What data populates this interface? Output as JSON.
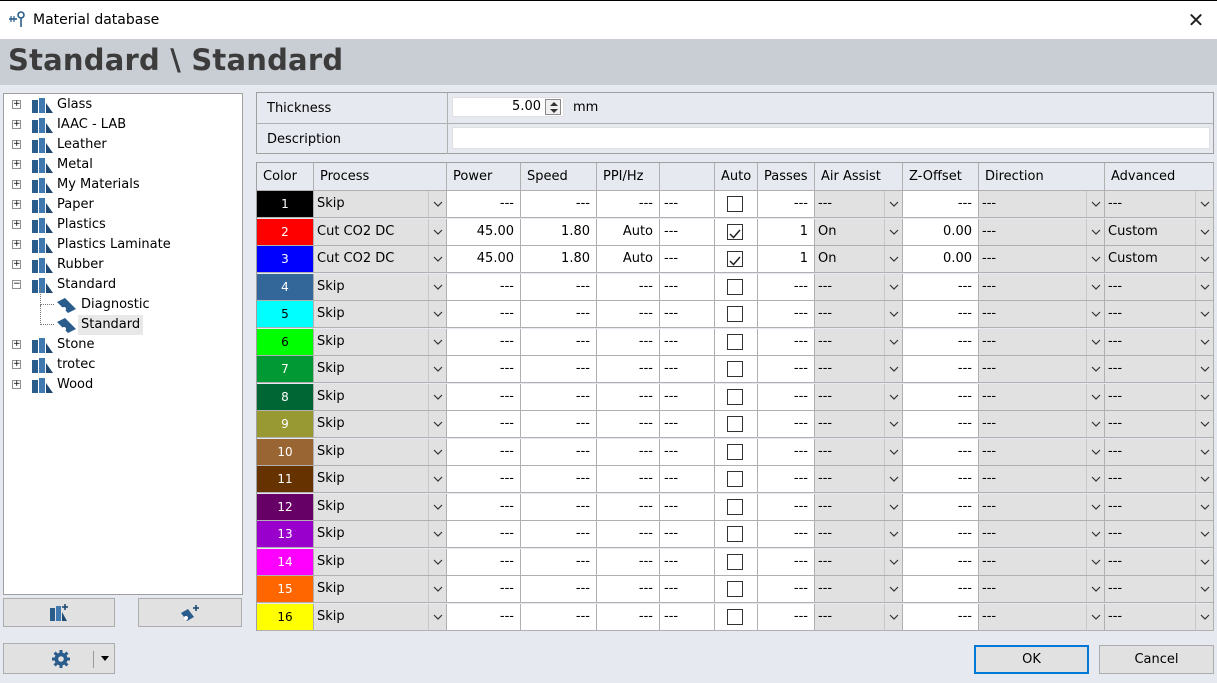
{
  "window": {
    "title": "Material database",
    "close_glyph": "✕"
  },
  "header": {
    "title": "Standard \\ Standard"
  },
  "tree": {
    "items": [
      {
        "label": "Glass",
        "kind": "folder",
        "expanded": false,
        "level": 0
      },
      {
        "label": "IAAC - LAB",
        "kind": "folder",
        "expanded": false,
        "level": 0
      },
      {
        "label": "Leather",
        "kind": "folder",
        "expanded": false,
        "level": 0
      },
      {
        "label": "Metal",
        "kind": "folder",
        "expanded": false,
        "level": 0
      },
      {
        "label": "My Materials",
        "kind": "folder",
        "expanded": false,
        "level": 0
      },
      {
        "label": "Paper",
        "kind": "folder",
        "expanded": false,
        "level": 0
      },
      {
        "label": "Plastics",
        "kind": "folder",
        "expanded": false,
        "level": 0
      },
      {
        "label": "Plastics Laminate",
        "kind": "folder",
        "expanded": false,
        "level": 0
      },
      {
        "label": "Rubber",
        "kind": "folder",
        "expanded": false,
        "level": 0
      },
      {
        "label": "Standard",
        "kind": "folder",
        "expanded": true,
        "level": 0
      },
      {
        "label": "Diagnostic",
        "kind": "material",
        "level": 1
      },
      {
        "label": "Standard",
        "kind": "material",
        "level": 1,
        "selected": true
      },
      {
        "label": "Stone",
        "kind": "folder",
        "expanded": false,
        "level": 0
      },
      {
        "label": "trotec",
        "kind": "folder",
        "expanded": false,
        "level": 0
      },
      {
        "label": "Wood",
        "kind": "folder",
        "expanded": false,
        "level": 0
      }
    ]
  },
  "toolbar": {
    "add_folder_icon": "add-folder-icon",
    "add_material_icon": "add-material-icon",
    "settings_icon": "gear-icon"
  },
  "properties": {
    "thickness_label": "Thickness",
    "thickness_value": "5.00",
    "thickness_unit": "mm",
    "description_label": "Description",
    "description_value": ""
  },
  "grid": {
    "headers": {
      "color": "Color",
      "process": "Process",
      "power": "Power",
      "speed": "Speed",
      "ppi": "PPI/Hz",
      "extra": "",
      "auto": "Auto",
      "passes": "Passes",
      "air_assist": "Air Assist",
      "z_offset": "Z-Offset",
      "direction": "Direction",
      "advanced": "Advanced"
    },
    "rows": [
      {
        "num": "1",
        "color": "#000000",
        "text_color": "#ffffff",
        "process": "Skip",
        "power": "---",
        "speed": "---",
        "ppi": "---",
        "extra": "---",
        "auto": false,
        "passes": "---",
        "air_assist": "---",
        "z_offset": "---",
        "direction": "---",
        "advanced": "---"
      },
      {
        "num": "2",
        "color": "#ff0000",
        "text_color": "#ffffff",
        "process": "Cut CO2 DC",
        "power": "45.00",
        "speed": "1.80",
        "ppi": "Auto",
        "extra": "---",
        "auto": true,
        "passes": "1",
        "air_assist": "On",
        "z_offset": "0.00",
        "direction": "---",
        "advanced": "Custom"
      },
      {
        "num": "3",
        "color": "#0000ff",
        "text_color": "#ffffff",
        "process": "Cut CO2 DC",
        "power": "45.00",
        "speed": "1.80",
        "ppi": "Auto",
        "extra": "---",
        "auto": true,
        "passes": "1",
        "air_assist": "On",
        "z_offset": "0.00",
        "direction": "---",
        "advanced": "Custom"
      },
      {
        "num": "4",
        "color": "#336699",
        "text_color": "#ffffff",
        "process": "Skip",
        "power": "---",
        "speed": "---",
        "ppi": "---",
        "extra": "---",
        "auto": false,
        "passes": "---",
        "air_assist": "---",
        "z_offset": "---",
        "direction": "---",
        "advanced": "---"
      },
      {
        "num": "5",
        "color": "#00ffff",
        "text_color": "#000000",
        "process": "Skip",
        "power": "---",
        "speed": "---",
        "ppi": "---",
        "extra": "---",
        "auto": false,
        "passes": "---",
        "air_assist": "---",
        "z_offset": "---",
        "direction": "---",
        "advanced": "---"
      },
      {
        "num": "6",
        "color": "#00ff00",
        "text_color": "#000000",
        "process": "Skip",
        "power": "---",
        "speed": "---",
        "ppi": "---",
        "extra": "---",
        "auto": false,
        "passes": "---",
        "air_assist": "---",
        "z_offset": "---",
        "direction": "---",
        "advanced": "---"
      },
      {
        "num": "7",
        "color": "#009933",
        "text_color": "#ffffff",
        "process": "Skip",
        "power": "---",
        "speed": "---",
        "ppi": "---",
        "extra": "---",
        "auto": false,
        "passes": "---",
        "air_assist": "---",
        "z_offset": "---",
        "direction": "---",
        "advanced": "---"
      },
      {
        "num": "8",
        "color": "#006633",
        "text_color": "#ffffff",
        "process": "Skip",
        "power": "---",
        "speed": "---",
        "ppi": "---",
        "extra": "---",
        "auto": false,
        "passes": "---",
        "air_assist": "---",
        "z_offset": "---",
        "direction": "---",
        "advanced": "---"
      },
      {
        "num": "9",
        "color": "#999933",
        "text_color": "#ffffff",
        "process": "Skip",
        "power": "---",
        "speed": "---",
        "ppi": "---",
        "extra": "---",
        "auto": false,
        "passes": "---",
        "air_assist": "---",
        "z_offset": "---",
        "direction": "---",
        "advanced": "---"
      },
      {
        "num": "10",
        "color": "#996633",
        "text_color": "#ffffff",
        "process": "Skip",
        "power": "---",
        "speed": "---",
        "ppi": "---",
        "extra": "---",
        "auto": false,
        "passes": "---",
        "air_assist": "---",
        "z_offset": "---",
        "direction": "---",
        "advanced": "---"
      },
      {
        "num": "11",
        "color": "#663300",
        "text_color": "#ffffff",
        "process": "Skip",
        "power": "---",
        "speed": "---",
        "ppi": "---",
        "extra": "---",
        "auto": false,
        "passes": "---",
        "air_assist": "---",
        "z_offset": "---",
        "direction": "---",
        "advanced": "---"
      },
      {
        "num": "12",
        "color": "#660066",
        "text_color": "#ffffff",
        "process": "Skip",
        "power": "---",
        "speed": "---",
        "ppi": "---",
        "extra": "---",
        "auto": false,
        "passes": "---",
        "air_assist": "---",
        "z_offset": "---",
        "direction": "---",
        "advanced": "---"
      },
      {
        "num": "13",
        "color": "#9900cc",
        "text_color": "#ffffff",
        "process": "Skip",
        "power": "---",
        "speed": "---",
        "ppi": "---",
        "extra": "---",
        "auto": false,
        "passes": "---",
        "air_assist": "---",
        "z_offset": "---",
        "direction": "---",
        "advanced": "---"
      },
      {
        "num": "14",
        "color": "#ff00ff",
        "text_color": "#ffffff",
        "process": "Skip",
        "power": "---",
        "speed": "---",
        "ppi": "---",
        "extra": "---",
        "auto": false,
        "passes": "---",
        "air_assist": "---",
        "z_offset": "---",
        "direction": "---",
        "advanced": "---"
      },
      {
        "num": "15",
        "color": "#ff6600",
        "text_color": "#ffffff",
        "process": "Skip",
        "power": "---",
        "speed": "---",
        "ppi": "---",
        "extra": "---",
        "auto": false,
        "passes": "---",
        "air_assist": "---",
        "z_offset": "---",
        "direction": "---",
        "advanced": "---"
      },
      {
        "num": "16",
        "color": "#ffff00",
        "text_color": "#000000",
        "process": "Skip",
        "power": "---",
        "speed": "---",
        "ppi": "---",
        "extra": "---",
        "auto": false,
        "passes": "---",
        "air_assist": "---",
        "z_offset": "---",
        "direction": "---",
        "advanced": "---"
      }
    ]
  },
  "footer": {
    "ok_label": "OK",
    "cancel_label": "Cancel"
  }
}
